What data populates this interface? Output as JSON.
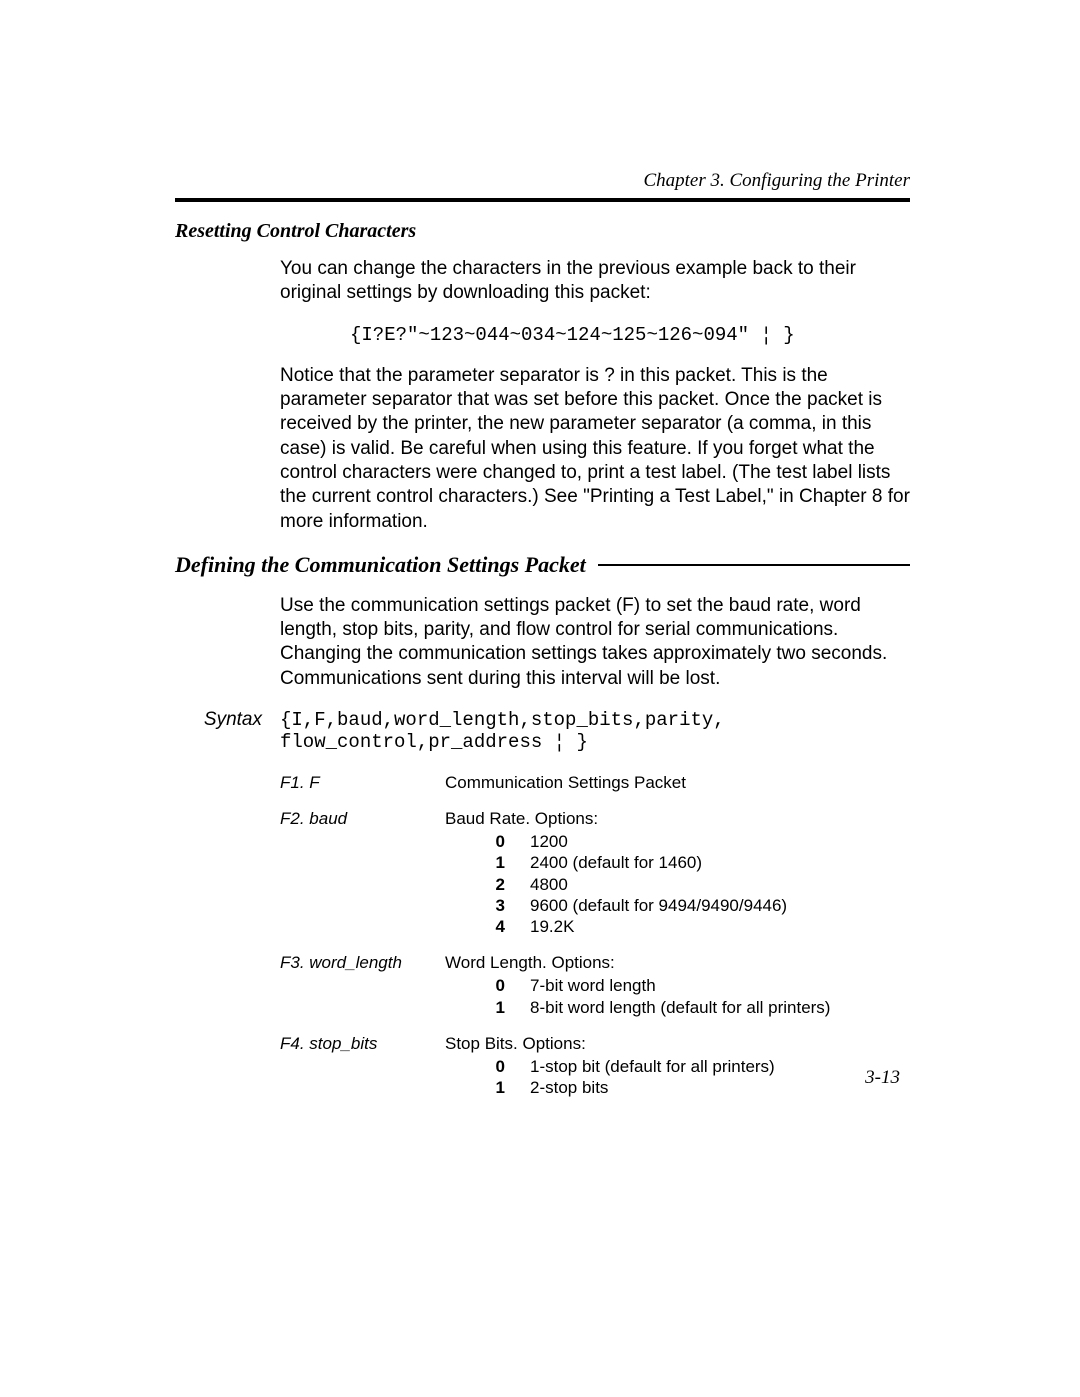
{
  "chapter": "Chapter 3.  Configuring the Printer",
  "subhead": "Resetting Control Characters",
  "p1": "You can change the characters in the previous example back to their original settings by downloading this packet:",
  "code1": "{I?E?\"~123~044~034~124~125~126~094\" ¦ }",
  "p2": "Notice that the parameter separator is ? in this packet.  This is the parameter separator that was set before this packet.  Once the packet is received by the printer, the new parameter separator (a comma, in this case) is valid.  Be careful when using this feature.  If you forget what the control characters were changed to, print a test label.  (The test label lists the current control characters.)  See \"Printing a Test Label,\" in Chapter 8 for more information.",
  "section2": "Defining the Communication Settings Packet",
  "p3": "Use the communication settings packet (F) to set the baud rate, word length, stop bits, parity, and flow control for serial communications.  Changing the communication settings takes approximately two seconds.  Communications sent during this interval will be lost.",
  "syntax_label": "Syntax",
  "syntax_code": "{I,F,baud,word_length,stop_bits,parity,\nflow_control,pr_address ¦ }",
  "fields": [
    {
      "label": "F1. F",
      "desc": "Communication Settings Packet",
      "options": []
    },
    {
      "label": "F2. baud",
      "desc": "Baud Rate.  Options:",
      "options": [
        {
          "k": "0",
          "v": "1200"
        },
        {
          "k": "1",
          "v": "2400 (default for 1460)"
        },
        {
          "k": "2",
          "v": "4800"
        },
        {
          "k": "3",
          "v": "9600 (default for 9494/9490/9446)"
        },
        {
          "k": "4",
          "v": "19.2K"
        }
      ]
    },
    {
      "label": "F3. word_length",
      "desc": "Word Length.  Options:",
      "options": [
        {
          "k": "0",
          "v": "7-bit word length"
        },
        {
          "k": "1",
          "v": "8-bit word length (default for all printers)"
        }
      ]
    },
    {
      "label": "F4. stop_bits",
      "desc": "Stop Bits.  Options:",
      "options": [
        {
          "k": "0",
          "v": "1-stop bit (default for all printers)"
        },
        {
          "k": "1",
          "v": "2-stop bits"
        }
      ]
    }
  ],
  "pagenum": "3-13"
}
